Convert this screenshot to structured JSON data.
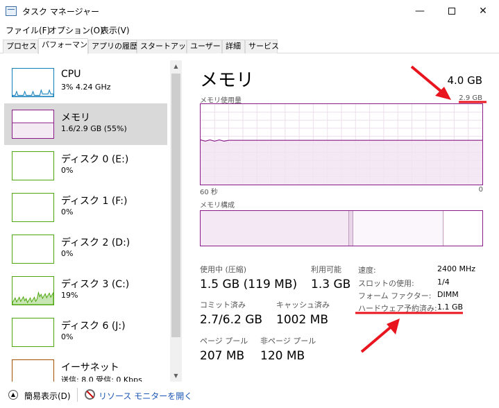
{
  "window": {
    "title": "タスク マネージャー",
    "minimize": "—",
    "maximize": "",
    "close": "✕"
  },
  "menu": [
    "ファイル(F)",
    "オプション(O)",
    "表示(V)"
  ],
  "tabs": [
    "プロセス",
    "パフォーマンス",
    "アプリの履歴",
    "スタートアップ",
    "ユーザー",
    "詳細",
    "サービス"
  ],
  "active_tab": "パフォーマンス",
  "devices": [
    {
      "name": "CPU",
      "sub": "3%  4.24 GHz",
      "color": "#117dbb",
      "level": 0.03
    },
    {
      "name": "メモリ",
      "sub": "1.6/2.9 GB (55%)",
      "color": "#8b1a89",
      "level": 0.55
    },
    {
      "name": "ディスク 0 (E:)",
      "sub": "0%",
      "color": "#4da60c",
      "level": 0
    },
    {
      "name": "ディスク 1 (F:)",
      "sub": "0%",
      "color": "#4da60c",
      "level": 0
    },
    {
      "name": "ディスク 2 (D:)",
      "sub": "0%",
      "color": "#4da60c",
      "level": 0
    },
    {
      "name": "ディスク 3 (C:)",
      "sub": "19%",
      "color": "#4da60c",
      "level": 0.19
    },
    {
      "name": "ディスク 6 (J:)",
      "sub": "0%",
      "color": "#4da60c",
      "level": 0
    },
    {
      "name": "イーサネット",
      "sub": "送信: 8.0  受信: 0 Kbps",
      "color": "#a74f01",
      "level": 0
    }
  ],
  "memory": {
    "heading": "メモリ",
    "total": "4.0 GB",
    "usage_label": "メモリ使用量",
    "usage_max": "2.9 GB",
    "time_left": "60 秒",
    "time_right": "0",
    "composition_label": "メモリ構成",
    "usage_fraction": 0.55,
    "composition": {
      "in_use": 0.527,
      "modified": 0.015,
      "standby": 0.32
    },
    "stats": {
      "in_use_label": "使用中 (圧縮)",
      "in_use_value": "1.5 GB (119 MB)",
      "available_label": "利用可能",
      "available_value": "1.3 GB",
      "committed_label": "コミット済み",
      "committed_value": "2.7/6.2 GB",
      "cached_label": "キャッシュ済み",
      "cached_value": "1002 MB",
      "paged_label": "ページ プール",
      "paged_value": "207 MB",
      "nonpaged_label": "非ページ プール",
      "nonpaged_value": "120 MB"
    },
    "specs": {
      "speed_label": "速度:",
      "speed_value": "2400 MHz",
      "slots_label": "スロットの使用:",
      "slots_value": "1/4",
      "form_label": "フォーム ファクター:",
      "form_value": "DIMM",
      "reserved_label": "ハードウェア予約済み:",
      "reserved_value": "1.1 GB"
    }
  },
  "footer": {
    "fewer_details": "簡易表示(D)",
    "resource_monitor": "リソース モニターを開く"
  },
  "colors": {
    "memory": "#8b1a89",
    "annotation": "#e8141e",
    "selected": "#d9d9d9"
  }
}
